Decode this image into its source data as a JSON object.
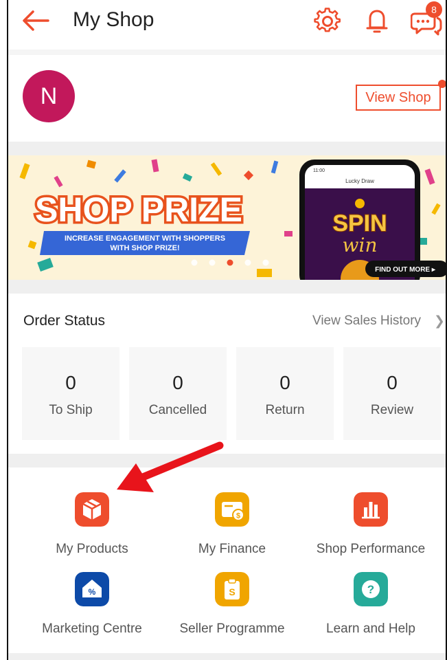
{
  "header": {
    "title": "My Shop",
    "chat_badge": "8"
  },
  "profile": {
    "avatar_letter": "N",
    "view_shop_label": "View Shop"
  },
  "banner": {
    "headline": "SHOP PRIZE",
    "subline_1": "INCREASE ENGAGEMENT WITH SHOPPERS",
    "subline_2": "WITH SHOP PRIZE!",
    "phone_time": "11:00",
    "phone_title": "Lucky Draw",
    "spin_text": "SPIN",
    "win_text": "win",
    "cta": "FIND OUT MORE ▸",
    "carousel_dots": 5,
    "active_dot_index": 2
  },
  "order_status": {
    "title": "Order Status",
    "link": "View Sales History",
    "tiles": [
      {
        "count": "0",
        "label": "To Ship"
      },
      {
        "count": "0",
        "label": "Cancelled"
      },
      {
        "count": "0",
        "label": "Return"
      },
      {
        "count": "0",
        "label": "Review"
      }
    ]
  },
  "tools": [
    {
      "label": "My Products",
      "icon": "box-icon",
      "color": "#ee4d2d"
    },
    {
      "label": "My Finance",
      "icon": "wallet-icon",
      "color": "#f0a500"
    },
    {
      "label": "Shop Performance",
      "icon": "bar-chart-icon",
      "color": "#ee4d2d"
    },
    {
      "label": "Marketing Centre",
      "icon": "discount-tag-icon",
      "color": "#0d4aa8"
    },
    {
      "label": "Seller Programme",
      "icon": "clipboard-dollar-icon",
      "color": "#f0a500"
    },
    {
      "label": "Learn and Help",
      "icon": "question-icon",
      "color": "#26aa99"
    }
  ],
  "colors": {
    "accent": "#ee4d2d",
    "annotation_arrow": "#e8141b"
  }
}
